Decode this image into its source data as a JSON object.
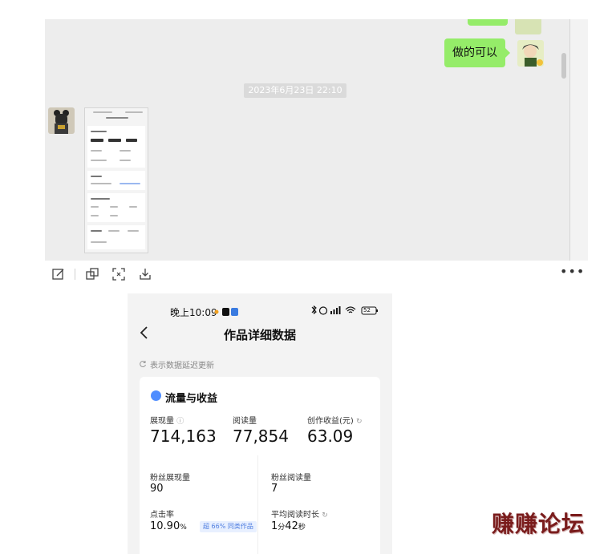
{
  "chat": {
    "message_text": "做的可以",
    "timestamp": "2023年6月23日 22:10"
  },
  "toolbar": {
    "more_label": "•••",
    "icons": [
      "edit-icon",
      "copy-icon",
      "scan-text-icon",
      "download-icon"
    ]
  },
  "phone": {
    "status_time": "晚上10:09",
    "battery": "52",
    "title": "作品详细数据",
    "delay_note": "表示数据延迟更新",
    "section_title": "流量与收益",
    "metrics": [
      {
        "label": "展现量",
        "value": "714,163"
      },
      {
        "label": "阅读量",
        "value": "77,854"
      },
      {
        "label": "创作收益(元)",
        "value": "63.09"
      }
    ],
    "sub_metrics": [
      {
        "label": "粉丝展现量",
        "value": "90"
      },
      {
        "label": "粉丝阅读量",
        "value": "7"
      },
      {
        "label": "点击率",
        "value": "10.90",
        "unit": "%"
      },
      {
        "label": "平均阅读时长",
        "value_min": "1",
        "unit_min": "分",
        "value_sec": "42",
        "unit_sec": "秒"
      }
    ],
    "click_badge": "超 66% 同类作品"
  },
  "watermark": "赚赚论坛",
  "colors": {
    "bubble_green": "#95ec69",
    "accent_blue": "#4f8dff",
    "watermark_red": "#7a1c1c"
  }
}
